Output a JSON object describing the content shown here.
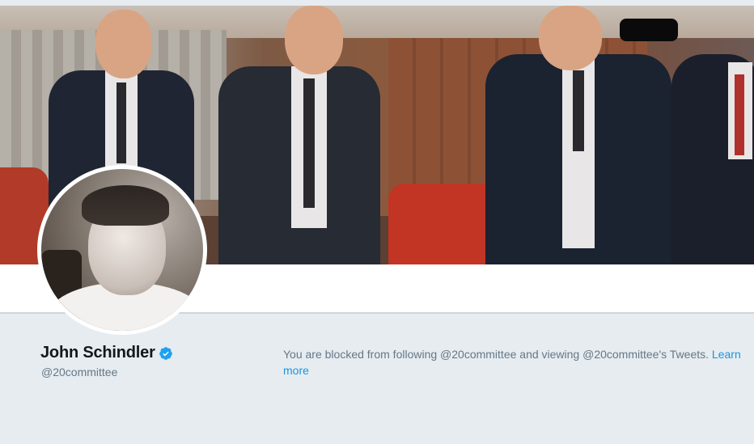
{
  "profile": {
    "display_name": "John Schindler",
    "handle": "@20committee",
    "verified": true,
    "verified_icon": "verified-badge-icon",
    "verified_color": "#1da1f2"
  },
  "blocked_notice": {
    "message": "You are blocked from following @20committee and viewing @20committee's Tweets. ",
    "link_label": "Learn more",
    "link_color": "#1b95e0"
  },
  "colors": {
    "page_background": "#e6ecf0",
    "text_primary": "#14171a",
    "text_secondary": "#657786"
  }
}
